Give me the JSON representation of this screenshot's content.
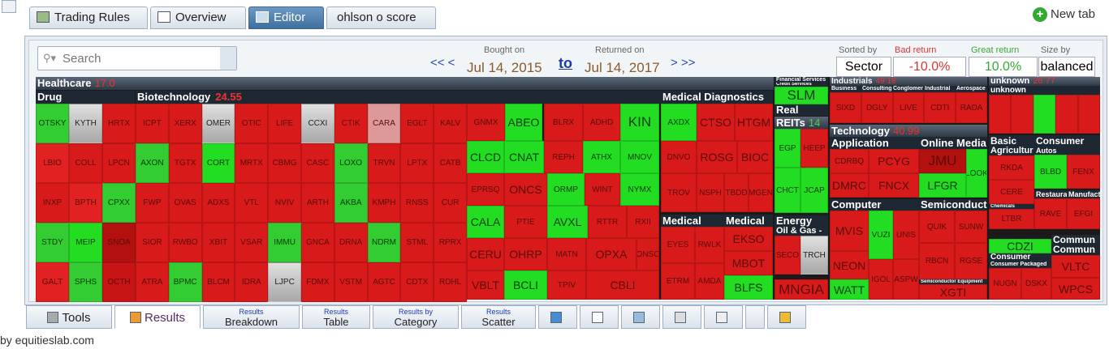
{
  "tabs": {
    "trading_rules": "Trading Rules",
    "overview": "Overview",
    "editor": "Editor",
    "ohlson": "ohlson o score",
    "new_tab": "New tab"
  },
  "search": {
    "placeholder": "Search"
  },
  "period": {
    "bought_label": "Bought on",
    "returned_label": "Returned on",
    "from": "Jul 14, 2015",
    "to_word": "to",
    "to": "Jul 14, 2017",
    "prev": "<< <",
    "next": "> >>"
  },
  "sort": {
    "sorted_by_label": "Sorted by",
    "sorted_by": "Sector",
    "bad_label": "Bad return",
    "bad": "-10.0%",
    "great_label": "Great return",
    "great": "10.0%",
    "size_label": "Size by",
    "size": "balanced"
  },
  "colors": {
    "bad": "#d91a1a",
    "great": "#22dd22",
    "neutral": "#a8a8a8"
  },
  "treemap": {
    "sectors": [
      {
        "name": "Healthcare",
        "pct": "17.0"
      },
      {
        "name": "Financial Services",
        "pct": ""
      },
      {
        "name": "Industrials",
        "pct": "49.18"
      },
      {
        "name": "unknown",
        "pct": "26.77"
      },
      {
        "name": "Technology",
        "pct": "40.99"
      },
      {
        "name": "Real",
        "pct": ""
      },
      {
        "name": "Energy",
        "pct": ""
      }
    ],
    "industries": {
      "drug": "Drug",
      "biotech": "Biotechnology",
      "biotech_pct": "24.55",
      "meddiag": "Medical Diagnostics",
      "medical1": "Medical",
      "medical2": "Medical",
      "reits": "REITs",
      "reits_pct": "14",
      "oilgas": "Oil & Gas -",
      "credit": "Credit Services",
      "business": "Business",
      "consulting": "Consulting",
      "conglomerates": "Conglomera",
      "industrial": "Industrial",
      "aerospace": "Aerospace",
      "unknown2": "unknown",
      "application": "Application",
      "online": "Online Media",
      "computer": "Computer",
      "semi": "Semiconduct",
      "basic": "Basic",
      "agri": "Agricultur",
      "consumer": "Consumer",
      "autos": "Autos",
      "restaurants": "Restaura",
      "manuf": "Manufact",
      "chemicals": "Chemicals",
      "commun1": "Commun",
      "commun2": "Commun",
      "consumer2": "Consumer",
      "consumer_packaged": "Consumer Packaged",
      "semi_equip": "Semiconductor Equipment",
      "biotechR": "Biotech"
    },
    "drug": [
      "OTSKY",
      "KYTH",
      "HRTX",
      "LBIO",
      "COLL",
      "LPCN",
      "INXP",
      "BPTH",
      "CPXX",
      "STDY",
      "MEIP",
      "SNOA",
      "GALT",
      "SPHS",
      "OCTH"
    ],
    "biotech": [
      "ICPT",
      "XERX",
      "OMER",
      "OTIC",
      "LIFE",
      "CCXI",
      "CTIK",
      "CARA",
      "EGLT",
      "KALV",
      "AXON",
      "TGTX",
      "CORT",
      "MRTX",
      "CBMG",
      "CASC",
      "LOXO",
      "TRVN",
      "LPTX",
      "CATB",
      "FWP",
      "OVAS",
      "ADXS",
      "VTL",
      "NVIV",
      "ARTH",
      "AKBA",
      "KMPH",
      "RNSS",
      "CUR",
      "SIOR",
      "RWBO",
      "XBIT",
      "VSAR",
      "IMMU",
      "GNCA",
      "DRNA",
      "NDRM",
      "STML",
      "RPRX",
      "ATRA",
      "BPMC",
      "BLCM",
      "IDRA",
      "LJPC",
      "FDMX",
      "VSTM",
      "AGTC",
      "CDTX",
      "RDHL"
    ],
    "biotech2": [
      "GNMX",
      "ABEO",
      "BLRX",
      "ADHD",
      "KIN",
      "CLCD",
      "CNAT",
      "REPH",
      "ATHX",
      "MNOV",
      "EPRSQ",
      "ONCS",
      "ORMP",
      "WINT",
      "NYMX",
      "CALA",
      "PTIE",
      "AVXL",
      "RTTR",
      "RXII",
      "CERU",
      "OHRP",
      "MATN",
      "OPXA",
      "ONSC",
      "VBLT",
      "BCLI",
      "TPIV",
      "CBLI"
    ],
    "meddiag": [
      "AXDX",
      "CTSO",
      "HTGM",
      "DNVO",
      "ROSG",
      "BIOC",
      "TROV",
      "NSPH",
      "TBDD",
      "MGEN"
    ],
    "medical": [
      "EYES",
      "RWLK",
      "EKSO",
      "ETRM",
      "AMDA",
      "MBOT",
      "BLFS"
    ],
    "fin": [
      "SLM",
      "EGP",
      "HEEP",
      "CHCT",
      "JCAP"
    ],
    "energy": [
      "TRCH",
      "MNGIA",
      "SECO"
    ],
    "ind": [
      "SIXD",
      "DGLY",
      "LIVE",
      "CDTI",
      "RADA"
    ],
    "app": [
      "CDRBQ",
      "PCYG",
      "DMRC",
      "FNCX"
    ],
    "online": [
      "JMU",
      "LFGR",
      "LOOK"
    ],
    "comp": [
      "MVIS",
      "VUZI",
      "NEON",
      "WATT",
      "UNIS",
      "ASPW",
      "IGOL"
    ],
    "semi": [
      "QUIK",
      "SUNW",
      "RBCN",
      "RGSE",
      "XGTI"
    ],
    "basic": [
      "RKDA",
      "CERE",
      "LTBR"
    ],
    "cons": [
      "BLBD",
      "FENX",
      "RAVE",
      "EFGI"
    ],
    "misc": [
      "CDZI",
      "NUGN",
      "DSKX",
      "VLTC",
      "WPCS"
    ]
  },
  "bottom_tabs": {
    "tools": "Tools",
    "results": "Results",
    "breakdown_small": "Results",
    "breakdown": "Breakdown",
    "table_small": "Results",
    "table": "Table",
    "category_small": "Results by",
    "category": "Category",
    "scatter_small": "Results",
    "scatter": "Scatter"
  },
  "footer": "by equitieslab.com"
}
